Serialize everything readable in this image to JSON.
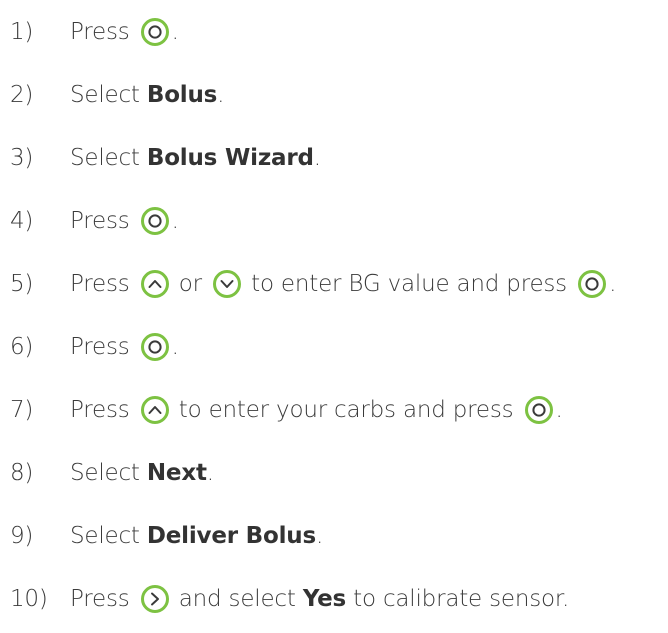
{
  "accent_color": "#7dc242",
  "steps": [
    {
      "num": "1)",
      "parts": [
        {
          "t": "Press "
        },
        {
          "icon": "select-icon"
        },
        {
          "t": "."
        }
      ]
    },
    {
      "num": "2)",
      "parts": [
        {
          "t": "Select "
        },
        {
          "b": "Bolus"
        },
        {
          "t": "."
        }
      ]
    },
    {
      "num": "3)",
      "parts": [
        {
          "t": "Select "
        },
        {
          "b": "Bolus Wizard"
        },
        {
          "t": "."
        }
      ]
    },
    {
      "num": "4)",
      "parts": [
        {
          "t": "Press "
        },
        {
          "icon": "select-icon"
        },
        {
          "t": "."
        }
      ]
    },
    {
      "num": "5)",
      "parts": [
        {
          "t": "Press "
        },
        {
          "icon": "up-arrow-icon"
        },
        {
          "t": " or "
        },
        {
          "icon": "down-arrow-icon"
        },
        {
          "t": " to enter BG value and press "
        },
        {
          "icon": "select-icon"
        },
        {
          "t": "."
        }
      ]
    },
    {
      "num": "6)",
      "parts": [
        {
          "t": "Press "
        },
        {
          "icon": "select-icon"
        },
        {
          "t": "."
        }
      ]
    },
    {
      "num": "7)",
      "parts": [
        {
          "t": "Press "
        },
        {
          "icon": "up-arrow-icon"
        },
        {
          "t": " to enter your carbs and press "
        },
        {
          "icon": "select-icon"
        },
        {
          "t": "."
        }
      ]
    },
    {
      "num": "8)",
      "parts": [
        {
          "t": "Select "
        },
        {
          "b": "Next"
        },
        {
          "t": "."
        }
      ]
    },
    {
      "num": "9)",
      "parts": [
        {
          "t": "Select "
        },
        {
          "b": "Deliver Bolus"
        },
        {
          "t": "."
        }
      ]
    },
    {
      "num": "10)",
      "parts": [
        {
          "t": "Press "
        },
        {
          "icon": "right-arrow-icon"
        },
        {
          "t": " and select "
        },
        {
          "b": "Yes"
        },
        {
          "t": " to calibrate sensor."
        }
      ]
    }
  ]
}
